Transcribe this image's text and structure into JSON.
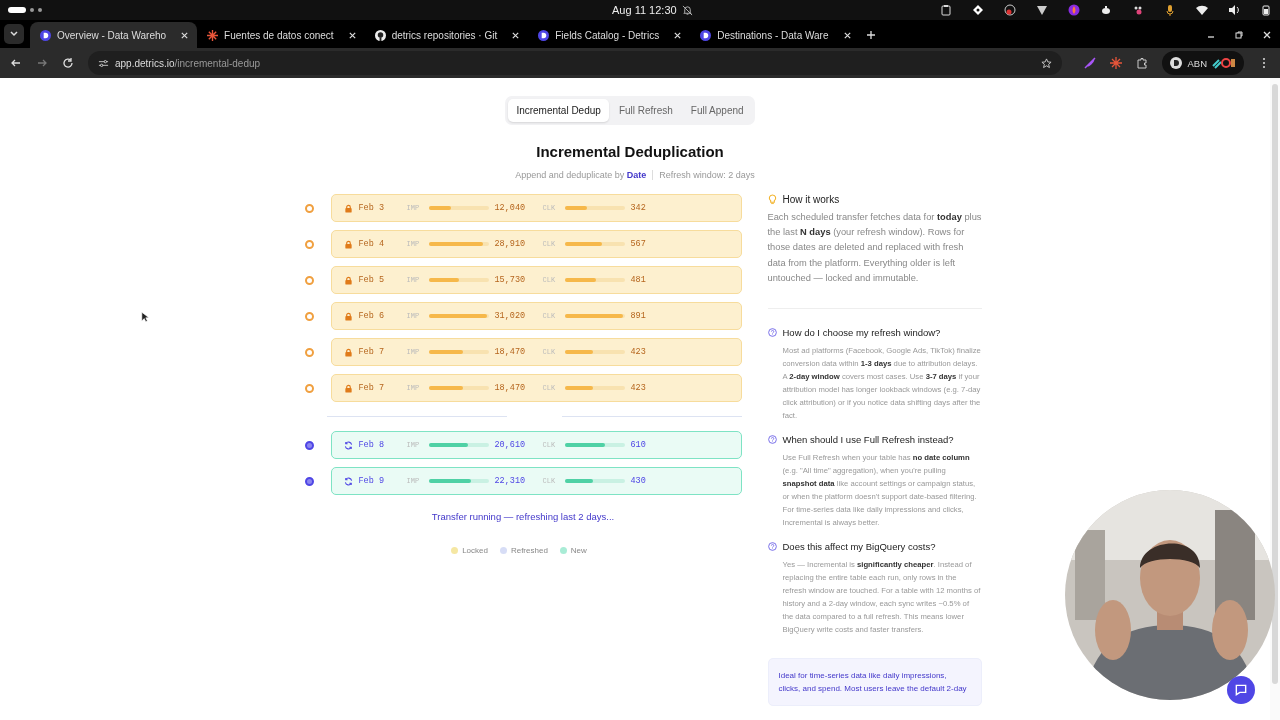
{
  "system_bar": {
    "clock": "Aug 11  12:30"
  },
  "tabs": [
    {
      "title": "Overview - Data Wareho",
      "selected": true
    },
    {
      "title": "Fuentes de datos conect",
      "selected": false
    },
    {
      "title": "detrics repositories · Git",
      "selected": false
    },
    {
      "title": "Fields Catalog - Detrics",
      "selected": false
    },
    {
      "title": "Destinations - Data Ware",
      "selected": false
    }
  ],
  "address_bar": {
    "host": "app.detrics.io",
    "path": "/incremental-dedup"
  },
  "profile": {
    "label": "ABN"
  },
  "mode_tabs": [
    {
      "label": "Incremental Dedup",
      "selected": true
    },
    {
      "label": "Full Refresh",
      "selected": false
    },
    {
      "label": "Full Append",
      "selected": false
    }
  ],
  "heading": "Incremental Deduplication",
  "subtitle": {
    "prefix": "Append and deduplicate by",
    "key": "Date",
    "window": "Refresh window: 2 days"
  },
  "rows": [
    {
      "kind": "locked",
      "date": "Feb 3",
      "impressions": {
        "label": "IMP",
        "level": 0.37,
        "value": "12,040"
      },
      "clicks": {
        "label": "CLK",
        "level": 0.37,
        "value": "342"
      }
    },
    {
      "kind": "locked",
      "date": "Feb 4",
      "impressions": {
        "label": "IMP",
        "level": 0.9,
        "value": "28,910"
      },
      "clicks": {
        "label": "CLK",
        "level": 0.63,
        "value": "567"
      }
    },
    {
      "kind": "locked",
      "date": "Feb 5",
      "impressions": {
        "label": "IMP",
        "level": 0.5,
        "value": "15,730"
      },
      "clicks": {
        "label": "CLK",
        "level": 0.53,
        "value": "481"
      }
    },
    {
      "kind": "locked",
      "date": "Feb 6",
      "impressions": {
        "label": "IMP",
        "level": 0.97,
        "value": "31,020"
      },
      "clicks": {
        "label": "CLK",
        "level": 0.98,
        "value": "891"
      }
    },
    {
      "kind": "locked",
      "date": "Feb 7",
      "impressions": {
        "label": "IMP",
        "level": 0.58,
        "value": "18,470"
      },
      "clicks": {
        "label": "CLK",
        "level": 0.47,
        "value": "423"
      }
    },
    {
      "kind": "locked",
      "date": "Feb 7",
      "impressions": {
        "label": "IMP",
        "level": 0.58,
        "value": "18,470"
      },
      "clicks": {
        "label": "CLK",
        "level": 0.47,
        "value": "423"
      }
    },
    {
      "kind": "refreshed",
      "date": "Feb 8",
      "impressions": {
        "label": "IMP",
        "level": 0.65,
        "value": "20,610"
      },
      "clicks": {
        "label": "CLK",
        "level": 0.67,
        "value": "610"
      }
    },
    {
      "kind": "refreshed",
      "date": "Feb 9",
      "impressions": {
        "label": "IMP",
        "level": 0.7,
        "value": "22,310"
      },
      "clicks": {
        "label": "CLK",
        "level": 0.47,
        "value": "430"
      }
    }
  ],
  "status": "Transfer running — refreshing last 2 days...",
  "legend": [
    {
      "label": "Locked",
      "color": "#f5e7a3"
    },
    {
      "label": "Refreshed",
      "color": "#d7ddf6"
    },
    {
      "label": "New",
      "color": "#a9ecd6"
    }
  ],
  "how_it_works": {
    "title": "How it works",
    "text": "Each scheduled transfer fetches data for **today** plus the last **N days** (your refresh window). Rows for those dates are deleted and replaced with fresh data from the platform. Everything older is left untouched — locked and immutable."
  },
  "faq": [
    {
      "question": "How do I choose my refresh window?",
      "answer": "Most ad platforms (Facebook, Google Ads, TikTok) finalize conversion data within **1-3 days** due to attribution delays. A **2-day window** covers most cases. Use **3-7 days** if your attribution model has longer lookback windows (e.g. 7-day click attribution) or if you notice data shifting days after the fact."
    },
    {
      "question": "When should I use Full Refresh instead?",
      "answer": "Use Full Refresh when your table has **no date column** (e.g. \"All time\" aggregation), when you're pulling **snapshot data** like account settings or campaign status, or when the platform doesn't support date-based filtering. For time-series data like daily impressions and clicks, Incremental is always better."
    },
    {
      "question": "Does this affect my BigQuery costs?",
      "answer": "Yes — Incremental is **significantly cheaper**. Instead of replacing the entire table each run, only rows in the refresh window are touched. For a table with 12 months of history and a 2-day window, each sync writes ~0.5% of the data compared to a full refresh. This means lower BigQuery write costs and faster transfers."
    }
  ],
  "tip": "Ideal for time-series data like daily impressions, clicks, and spend. Most users leave the default 2-day"
}
